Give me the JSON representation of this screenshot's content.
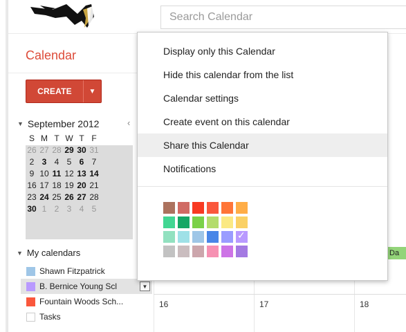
{
  "search": {
    "placeholder": "Search Calendar"
  },
  "app": {
    "title": "Calendar"
  },
  "create": {
    "label": "CREATE",
    "arrow": "▼"
  },
  "mini_calendar": {
    "month_label": "September 2012",
    "collapse_icon": "▼",
    "prev_icon": "‹",
    "dow": [
      "S",
      "M",
      "T",
      "W",
      "T",
      "F"
    ],
    "weeks": [
      [
        {
          "d": "26",
          "c": "dim"
        },
        {
          "d": "27",
          "c": "dim"
        },
        {
          "d": "28",
          "c": "dim"
        },
        {
          "d": "29",
          "c": "bold dim"
        },
        {
          "d": "30",
          "c": "bold dim"
        },
        {
          "d": "31",
          "c": "dim"
        }
      ],
      [
        {
          "d": "2",
          "c": ""
        },
        {
          "d": "3",
          "c": "bold"
        },
        {
          "d": "4",
          "c": ""
        },
        {
          "d": "5",
          "c": ""
        },
        {
          "d": "6",
          "c": "bold"
        },
        {
          "d": "7",
          "c": ""
        }
      ],
      [
        {
          "d": "9",
          "c": ""
        },
        {
          "d": "10",
          "c": ""
        },
        {
          "d": "11",
          "c": "bold"
        },
        {
          "d": "12",
          "c": ""
        },
        {
          "d": "13",
          "c": "bold"
        },
        {
          "d": "14",
          "c": "bold"
        }
      ],
      [
        {
          "d": "16",
          "c": ""
        },
        {
          "d": "17",
          "c": ""
        },
        {
          "d": "18",
          "c": ""
        },
        {
          "d": "19",
          "c": ""
        },
        {
          "d": "20",
          "c": "bold"
        },
        {
          "d": "21",
          "c": ""
        }
      ],
      [
        {
          "d": "23",
          "c": ""
        },
        {
          "d": "24",
          "c": "bold"
        },
        {
          "d": "25",
          "c": ""
        },
        {
          "d": "26",
          "c": "bold"
        },
        {
          "d": "27",
          "c": "bold"
        },
        {
          "d": "28",
          "c": ""
        }
      ],
      [
        {
          "d": "30",
          "c": "bold"
        },
        {
          "d": "1",
          "c": "dim"
        },
        {
          "d": "2",
          "c": "dim"
        },
        {
          "d": "3",
          "c": "dim"
        },
        {
          "d": "4",
          "c": "dim"
        },
        {
          "d": "5",
          "c": "dim"
        }
      ]
    ]
  },
  "my_calendars": {
    "heading": "My calendars",
    "items": [
      {
        "label": "Shawn Fitzpatrick",
        "color": "#9fc6e7",
        "active": false
      },
      {
        "label": "B. Bernice Young Scl",
        "color": "#b99aff",
        "active": true
      },
      {
        "label": "Fountain Woods Sch...",
        "color": "#fa573c",
        "active": false
      },
      {
        "label": "Tasks",
        "color": "#ffffff",
        "active": false
      }
    ]
  },
  "grid": {
    "day_numbers": [
      "16",
      "17",
      "18"
    ],
    "event_peek": "Da"
  },
  "menu": {
    "items": [
      {
        "label": "Display only this Calendar"
      },
      {
        "label": "Hide this calendar from the list"
      },
      {
        "label": "Calendar settings"
      },
      {
        "label": "Create event on this calendar"
      },
      {
        "label": "Share this Calendar",
        "hover": true
      },
      {
        "label": "Notifications"
      }
    ],
    "palette": [
      [
        "#ac725e",
        "#d06b64",
        "#f83a22",
        "#fa573c",
        "#ff7537",
        "#ffad46"
      ],
      [
        "#42d692",
        "#16a765",
        "#7bd148",
        "#b3dc6c",
        "#fbe983",
        "#fad165"
      ],
      [
        "#92e1c0",
        "#9fe1e7",
        "#9fc6e7",
        "#4986e7",
        "#9a9cff",
        "#b99aff"
      ],
      [
        "#c2c2c2",
        "#cabdbf",
        "#cca6ac",
        "#f691b2",
        "#cd74e6",
        "#a47ae2"
      ]
    ],
    "selected_color": "#b99aff"
  }
}
